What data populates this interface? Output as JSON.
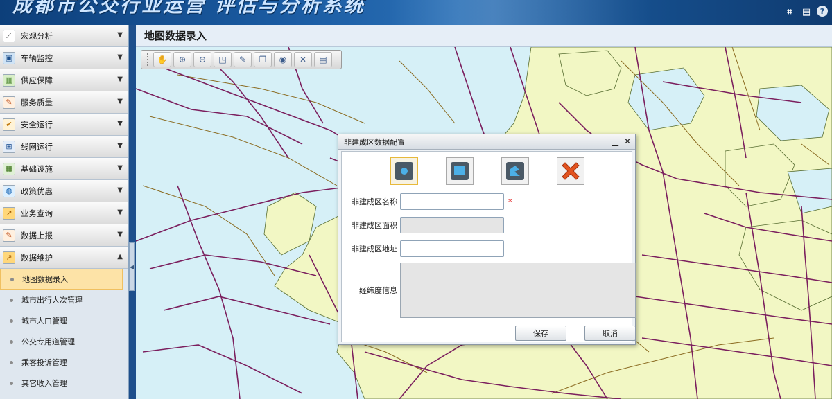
{
  "app": {
    "title": "成都市公交行业运营 评估与分析系统",
    "header_icons": [
      "crop-icon",
      "window-icon",
      "help-icon"
    ]
  },
  "sidebar": {
    "menu": [
      {
        "label": "宏观分析",
        "icon": "chart-line-icon"
      },
      {
        "label": "车辆监控",
        "icon": "bus-icon"
      },
      {
        "label": "供应保障",
        "icon": "supply-icon"
      },
      {
        "label": "服务质量",
        "icon": "pencil-icon"
      },
      {
        "label": "安全运行",
        "icon": "check-icon"
      },
      {
        "label": "线网运行",
        "icon": "network-icon"
      },
      {
        "label": "基础设施",
        "icon": "building-icon"
      },
      {
        "label": "政策优惠",
        "icon": "globe-icon"
      },
      {
        "label": "业务查询",
        "icon": "chart-up-icon"
      },
      {
        "label": "数据上报",
        "icon": "report-icon"
      },
      {
        "label": "数据维护",
        "icon": "maintenance-icon",
        "expanded": true
      }
    ],
    "submenu": [
      {
        "label": "地图数据录入",
        "active": true
      },
      {
        "label": "城市出行人次管理"
      },
      {
        "label": "城市人口管理"
      },
      {
        "label": "公交专用道管理"
      },
      {
        "label": "乘客投诉管理"
      },
      {
        "label": "其它收入管理"
      }
    ]
  },
  "main": {
    "title": "地图数据录入",
    "toolbar": [
      "pan-hand-icon",
      "zoom-in-icon",
      "zoom-out-icon",
      "full-extent-icon",
      "edit-icon",
      "layers-icon",
      "select-icon",
      "clear-icon",
      "save-map-icon"
    ]
  },
  "dialog": {
    "title": "非建成区数据配置",
    "shape_tools": [
      "point-tool",
      "rectangle-tool",
      "polygon-tool",
      "delete-tool"
    ],
    "fields": {
      "name_label": "非建成区名称",
      "area_label": "非建成区面积",
      "address_label": "非建成区地址",
      "coords_label": "经纬度信息",
      "required_mark": "*"
    },
    "save_label": "保存",
    "cancel_label": "取消"
  },
  "colors": {
    "map_water": "#d6f0f7",
    "map_land": "#f2f7c4",
    "road_primary": "#7b1f5e",
    "road_secondary": "#8a6a20",
    "banner": "#1b5ca3",
    "active_item": "#fde3a7"
  }
}
